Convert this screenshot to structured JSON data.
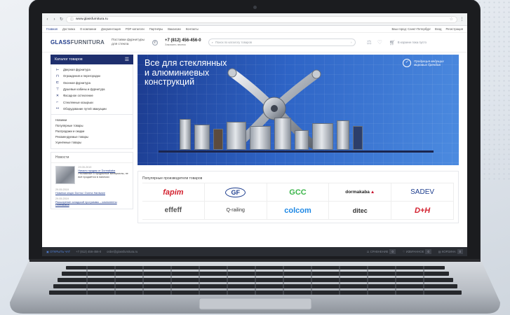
{
  "browser": {
    "url": "www.glassfurnitura.ru"
  },
  "topnav": {
    "items": [
      "Главная",
      "Доставка",
      "О компании",
      "Документация",
      "PDF-каталоги",
      "Партнёры",
      "Вакансии",
      "Контакты"
    ],
    "right": [
      "Ваш город: Санкт-Петербург",
      "Вход",
      "Регистрация"
    ]
  },
  "header": {
    "logo_main": "GLASS",
    "logo_sub": "FURNITURA",
    "tagline": "Поставки фурнитуры для стекла",
    "phone": "+7 (812) 456-456-0",
    "callback": "Заказать звонок",
    "search_placeholder": "Поиск по каталогу товаров",
    "cart_text": "В корзине пока пусто"
  },
  "sidebar": {
    "catalog_title": "Каталог товаров",
    "categories": [
      "Дверная фурнитура",
      "Ограждения и перегородки",
      "Оконная фурнитура",
      "Душевые кабины и фурнитура",
      "Фасадное остекление",
      "Стеклянные козырьки",
      "Оборудование путей эвакуации"
    ],
    "links": [
      "Новинки",
      "Популярные товары",
      "Распродажи и скидки",
      "Рекомендуемые товары",
      "Уценённые товары"
    ],
    "news_title": "Новости",
    "news": [
      {
        "date": "29.05.2019",
        "title": "Начало продаж от Dormakaba",
        "text": "Рекламные и продажные материалы, не всё продаётся в наличии"
      },
      {
        "date": "29.05.2019",
        "title": "Новинки опции Dorma / Dorma Hardware"
      },
      {
        "date": "29.05.2019",
        "title": "Расширение складской программы – компоненты Dormakaba"
      }
    ]
  },
  "banner": {
    "line1": "Все для стеклянных",
    "line2": "и алюминиевых",
    "line3": "конструкций",
    "badge_line1": "Продукция ведущих",
    "badge_line2": "мировых брендов"
  },
  "producers": {
    "title": "Популярные производители товаров",
    "brands": [
      {
        "name": "fapim",
        "color": "#d3202e"
      },
      {
        "name": "GF",
        "color": "#1f3f8f"
      },
      {
        "name": "GCC",
        "color": "#3bb54a"
      },
      {
        "name": "dormakaba",
        "color": "#c8102e"
      },
      {
        "name": "SADEV",
        "color": "#1f3f8f"
      },
      {
        "name": "effeff",
        "color": "#555555"
      },
      {
        "name": "Q-railing",
        "color": "#333333"
      },
      {
        "name": "colcom",
        "color": "#1e88e5"
      },
      {
        "name": "ditec",
        "color": "#333333"
      },
      {
        "name": "D+H",
        "color": "#d3202e"
      }
    ]
  },
  "footer": {
    "left1": "ОТКРЫТЬ ЧАТ",
    "phone": "+7 (812) 456-456-0",
    "email": "order@glassfurnitura.ru",
    "compare": "СРАВНЕНИЕ",
    "compare_count": "0",
    "favorites": "ИЗБРАННОЕ",
    "favorites_count": "0",
    "cart": "КОРЗИНА",
    "cart_count": "0"
  }
}
